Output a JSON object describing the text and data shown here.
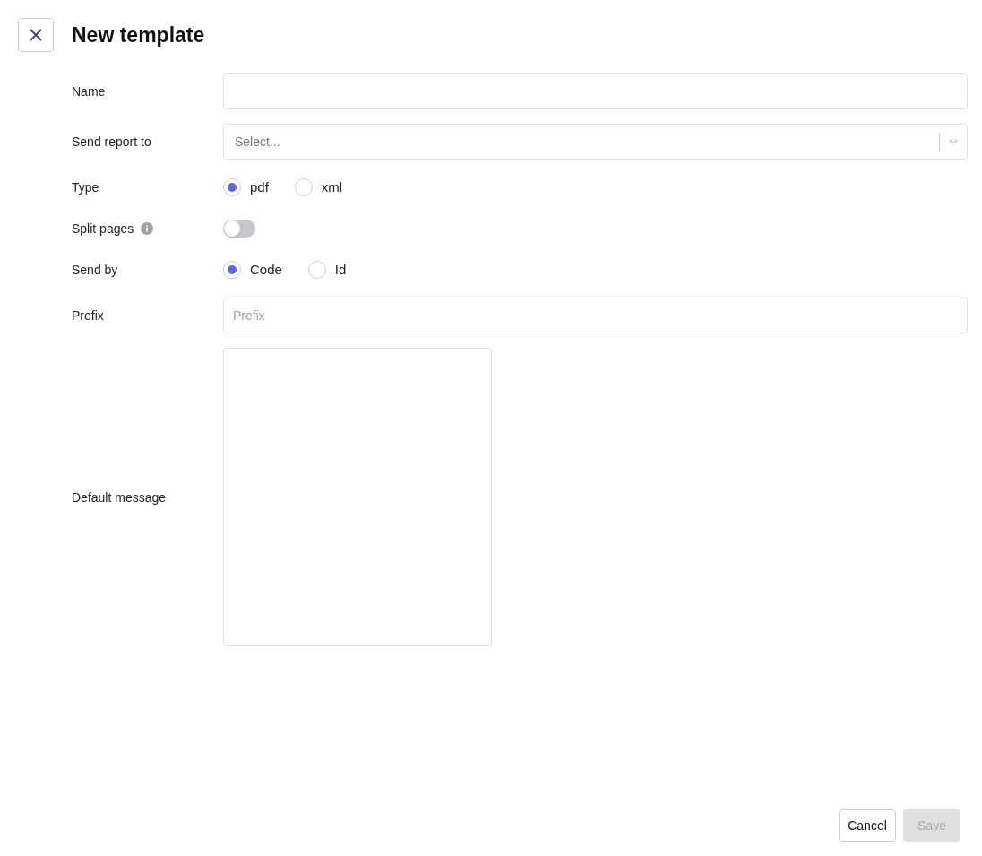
{
  "title": "New template",
  "fields": [
    {
      "kind": "text",
      "label": "Name"
    },
    {
      "kind": "select",
      "label": "Send report to",
      "placeholder": "Select..."
    },
    {
      "kind": "radio",
      "label": "Type",
      "options": [
        {
          "label": "pdf",
          "selected": true
        },
        {
          "label": "xml",
          "selected": false
        }
      ]
    },
    {
      "kind": "toggle",
      "label": "Split pages",
      "info": true,
      "on": false
    },
    {
      "kind": "radio",
      "label": "Send by",
      "options": [
        {
          "label": "Code",
          "selected": true
        },
        {
          "label": "Id",
          "selected": false
        }
      ]
    },
    {
      "kind": "text",
      "label": "Prefix",
      "placeholder": "Prefix"
    },
    {
      "kind": "textarea",
      "label": "Default message"
    }
  ],
  "buttons": [
    {
      "label": "Cancel",
      "disabled": false
    },
    {
      "label": "Save",
      "disabled": true
    }
  ]
}
